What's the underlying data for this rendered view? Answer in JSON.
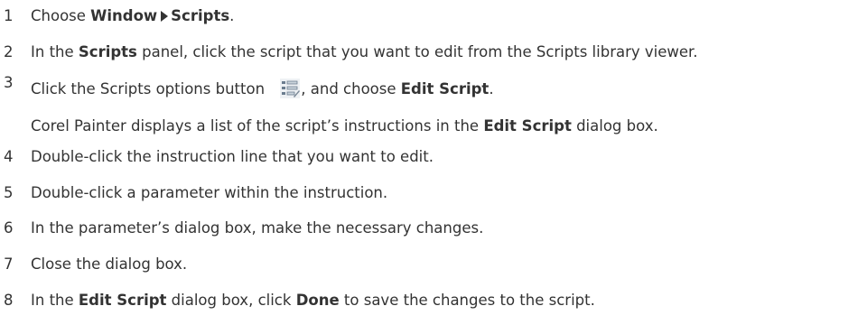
{
  "steps": [
    {
      "number": "1",
      "parts": [
        "Choose ",
        "Window",
        "Scripts",
        "."
      ]
    },
    {
      "number": "2",
      "parts": [
        "In the ",
        "Scripts",
        " panel, click the script that you want to edit from the Scripts library viewer."
      ]
    },
    {
      "number": "3",
      "parts": [
        "Click the Scripts options button ",
        ", and choose ",
        "Edit Script",
        "."
      ],
      "icon": "scripts-options-icon"
    },
    {
      "number": "",
      "parts": [
        "Corel Painter displays a list of the script’s instructions in the ",
        "Edit Script",
        " dialog box."
      ]
    },
    {
      "number": "4",
      "parts": [
        "Double-click the instruction line that you want to edit."
      ]
    },
    {
      "number": "5",
      "parts": [
        "Double-click a parameter within the instruction."
      ]
    },
    {
      "number": "6",
      "parts": [
        "In the parameter’s dialog box, make the necessary changes."
      ]
    },
    {
      "number": "7",
      "parts": [
        "Close the dialog box."
      ]
    },
    {
      "number": "8",
      "parts": [
        "In the ",
        "Edit Script",
        " dialog box, click ",
        "Done",
        " to save the changes to the script."
      ]
    }
  ],
  "menu_separator_icon": "right-triangle-icon"
}
